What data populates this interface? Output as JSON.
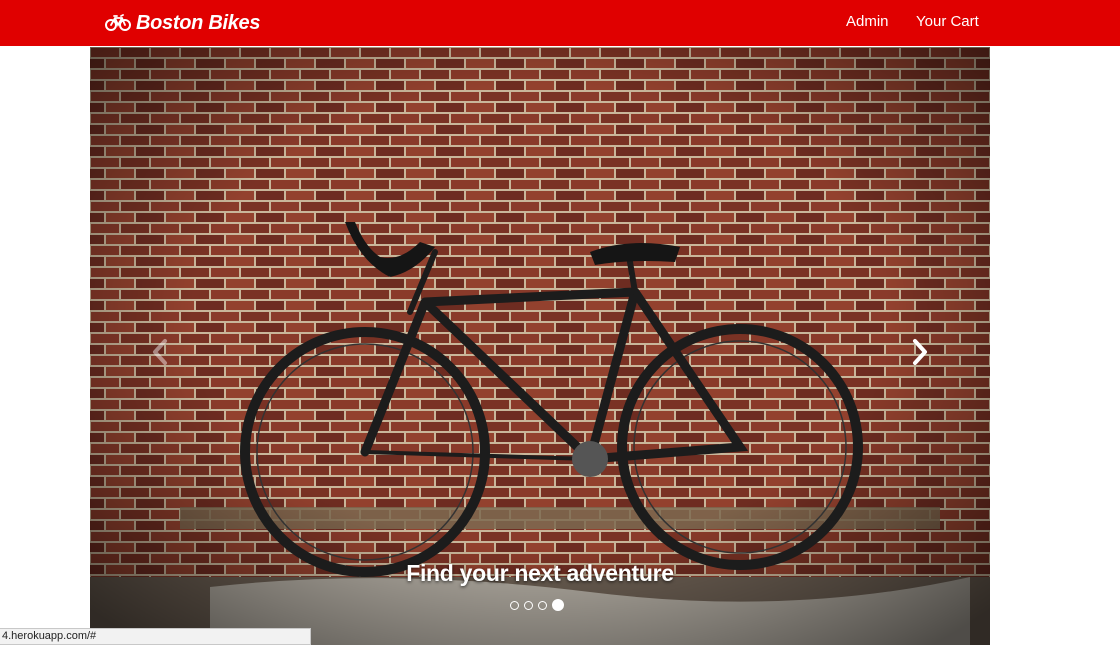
{
  "brand": {
    "name": "Boston Bikes",
    "icon": "bicycle-icon",
    "color": "#e00000"
  },
  "nav": {
    "admin_label": "Admin",
    "cart_label": "Your Cart"
  },
  "carousel": {
    "caption": "Find your next adventure",
    "indicator_count": 4,
    "active_index": 3,
    "prev_icon": "chevron-left-icon",
    "next_icon": "chevron-right-icon"
  },
  "status_bar": {
    "url": "4.herokuapp.com/#"
  }
}
